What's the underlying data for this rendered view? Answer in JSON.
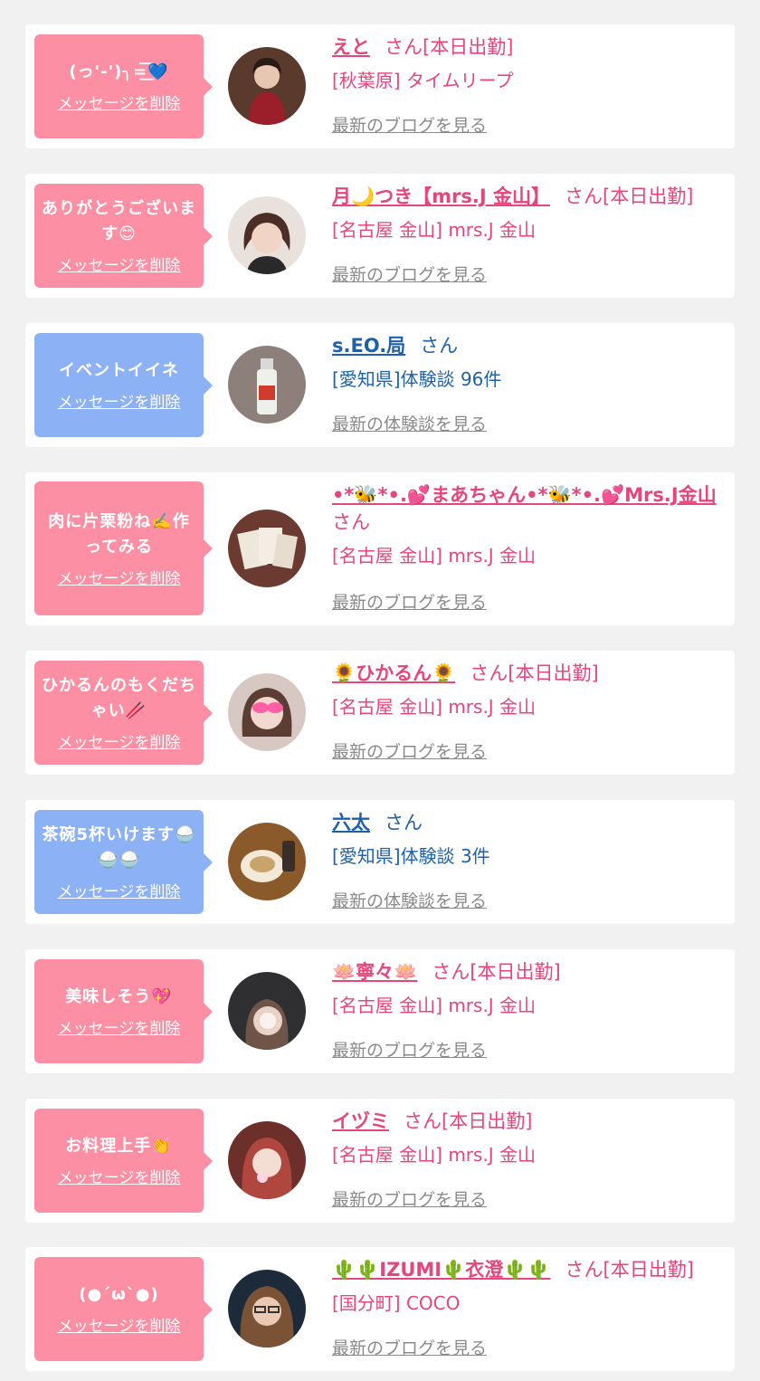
{
  "messages": [
    {
      "type": "blog",
      "bubble_color": "#fd8fa5",
      "message": "(っ'-')╮=͟͟͞͞💙",
      "delete_label": "メッセージを削除",
      "name": "えと",
      "suffix": "さん[本日出勤]",
      "sub": "[秋葉原] タイムリープ",
      "link": "最新のブログを見る"
    },
    {
      "type": "blog",
      "bubble_color": "#fd8fa5",
      "message": "ありがとうございます😊",
      "delete_label": "メッセージを削除",
      "name": "月🌙つき【mrs.J 金山】",
      "suffix": "さん[本日出勤]",
      "sub": "[名古屋 金山] mrs.J 金山",
      "link": "最新のブログを見る"
    },
    {
      "type": "review",
      "bubble_color": "#8db1f5",
      "message": "イベントイイネ",
      "delete_label": "メッセージを削除",
      "name": "s.EO.局",
      "suffix": "さん",
      "sub": "[愛知県]体験談 96件",
      "link": "最新の体験談を見る"
    },
    {
      "type": "blog",
      "bubble_color": "#fd8fa5",
      "message": "肉に片栗粉ね✍️作ってみる",
      "delete_label": "メッセージを削除",
      "name": "•*🐝*•.💕まあちゃん•*🐝*•.💕Mrs.J金山",
      "suffix": "さん",
      "sub": "[名古屋 金山] mrs.J 金山",
      "link": "最新のブログを見る"
    },
    {
      "type": "blog",
      "bubble_color": "#fd8fa5",
      "message": "ひかるんのもくだちゃい🥢",
      "delete_label": "メッセージを削除",
      "name": "🌻ひかるん🌻",
      "suffix": "さん[本日出勤]",
      "sub": "[名古屋 金山] mrs.J 金山",
      "link": "最新のブログを見る"
    },
    {
      "type": "review",
      "bubble_color": "#8db1f5",
      "message": "茶碗5杯いけます🍚🍚🍚",
      "delete_label": "メッセージを削除",
      "name": "六太",
      "suffix": "さん",
      "sub": "[愛知県]体験談 3件",
      "link": "最新の体験談を見る"
    },
    {
      "type": "blog",
      "bubble_color": "#fd8fa5",
      "message": "美味しそう💖",
      "delete_label": "メッセージを削除",
      "name": "🪷寧々🪷",
      "suffix": "さん[本日出勤]",
      "sub": "[名古屋 金山] mrs.J 金山",
      "link": "最新のブログを見る"
    },
    {
      "type": "blog",
      "bubble_color": "#fd8fa5",
      "message": "お料理上手👏",
      "delete_label": "メッセージを削除",
      "name": "イヅミ",
      "suffix": "さん[本日出勤]",
      "sub": "[名古屋 金山] mrs.J 金山",
      "link": "最新のブログを見る"
    },
    {
      "type": "blog",
      "bubble_color": "#fd8fa5",
      "message": "(●´ω`●)",
      "delete_label": "メッセージを削除",
      "name": "🌵🌵IZUMI🌵衣澄🌵🌵",
      "suffix": "さん[本日出勤]",
      "sub": "[国分町] COCO",
      "link": "最新のブログを見る"
    }
  ]
}
